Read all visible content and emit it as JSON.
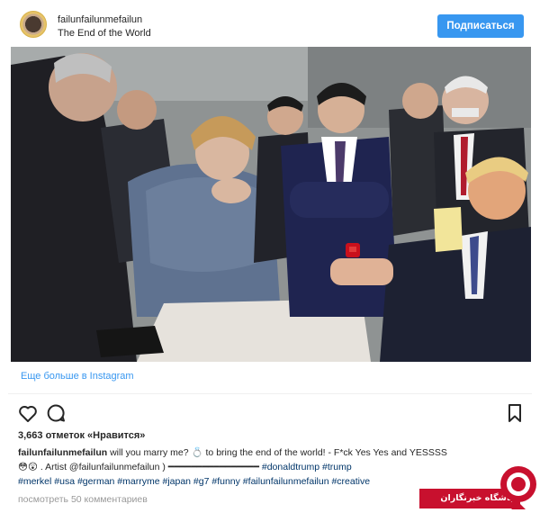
{
  "header": {
    "username": "failunfailunmefailun",
    "location": "The End of the World",
    "follow_label": "Подписаться"
  },
  "post": {
    "more_link": "Еще больше в Instagram",
    "likes": "3,663 отметок «Нравится»",
    "caption": {
      "user": "failunfailunmefailun",
      "line1_text": "will you marry me? 💍 to bring the end of the world! - F*ck Yes Yes and YESSSS",
      "line2_emojis": "😳😲",
      "line2_text": ". Artist @failunfailunmefailun ) ━━━━━━━━━━━━━━━━",
      "line2_tags": "#donaldtrump #trump",
      "line3_tags": "#merkel #usa #german #marryme #japan #g7 #funny #failunfailunmefailun #creative"
    },
    "comments": "посмотреть 50 комментариев"
  },
  "icons": {
    "heart": "heart-icon",
    "comment": "comment-icon",
    "bookmark": "bookmark-icon"
  },
  "watermark": {
    "label": "باشگاه خبرنگاران"
  },
  "colors": {
    "accent": "#3897f0",
    "text": "#262626",
    "muted": "#999999",
    "hashtag": "#003569",
    "watermark": "#c8102e"
  }
}
